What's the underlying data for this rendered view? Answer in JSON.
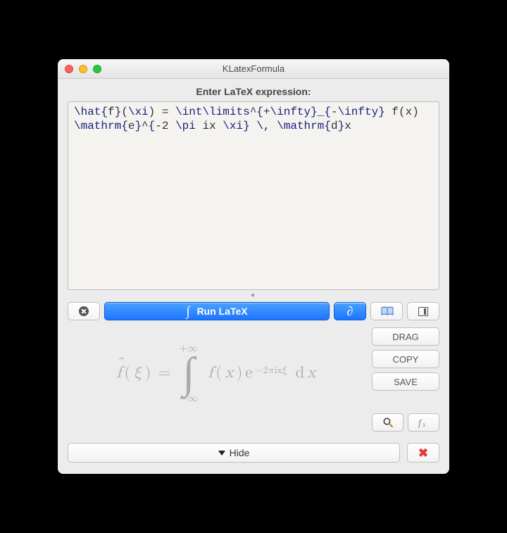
{
  "window": {
    "title": "KLatexFormula"
  },
  "editor": {
    "label": "Enter LaTeX expression:",
    "value": "\\hat{f}(\\xi) = \\int\\limits^{+\\infty}_{-\\infty} f(x) \\mathrm{e}^{-2 \\pi ix \\xi} \\, \\mathrm{d}x"
  },
  "toolbar": {
    "clear_icon": "clear-icon",
    "run_label": "Run LaTeX",
    "run_icon": "integral-icon",
    "symbols_icon": "partial-icon",
    "symbols_label": "∂",
    "library_icon": "book-icon",
    "expand_icon": "panel-toggle-icon"
  },
  "preview": {
    "formula_latex": "\\hat{f}(\\xi) = \\int\\limits^{+\\infty}_{-\\infty} f(x)\\mathrm{e}^{-2\\pi ix\\xi}\\,\\mathrm{d}x",
    "upper_limit": "+∞",
    "lower_limit": "−∞",
    "exponent": "−2πixξ"
  },
  "side": {
    "drag_label": "DRAG",
    "copy_label": "COPY",
    "save_label": "SAVE",
    "zoom_icon": "magnifier-icon",
    "fx_icon": "fx-icon"
  },
  "footer": {
    "hide_label": "Hide",
    "close_icon": "close-icon"
  },
  "colors": {
    "accent": "#1e74ff",
    "preview_text": "#a9a9a9",
    "danger": "#e53935"
  }
}
